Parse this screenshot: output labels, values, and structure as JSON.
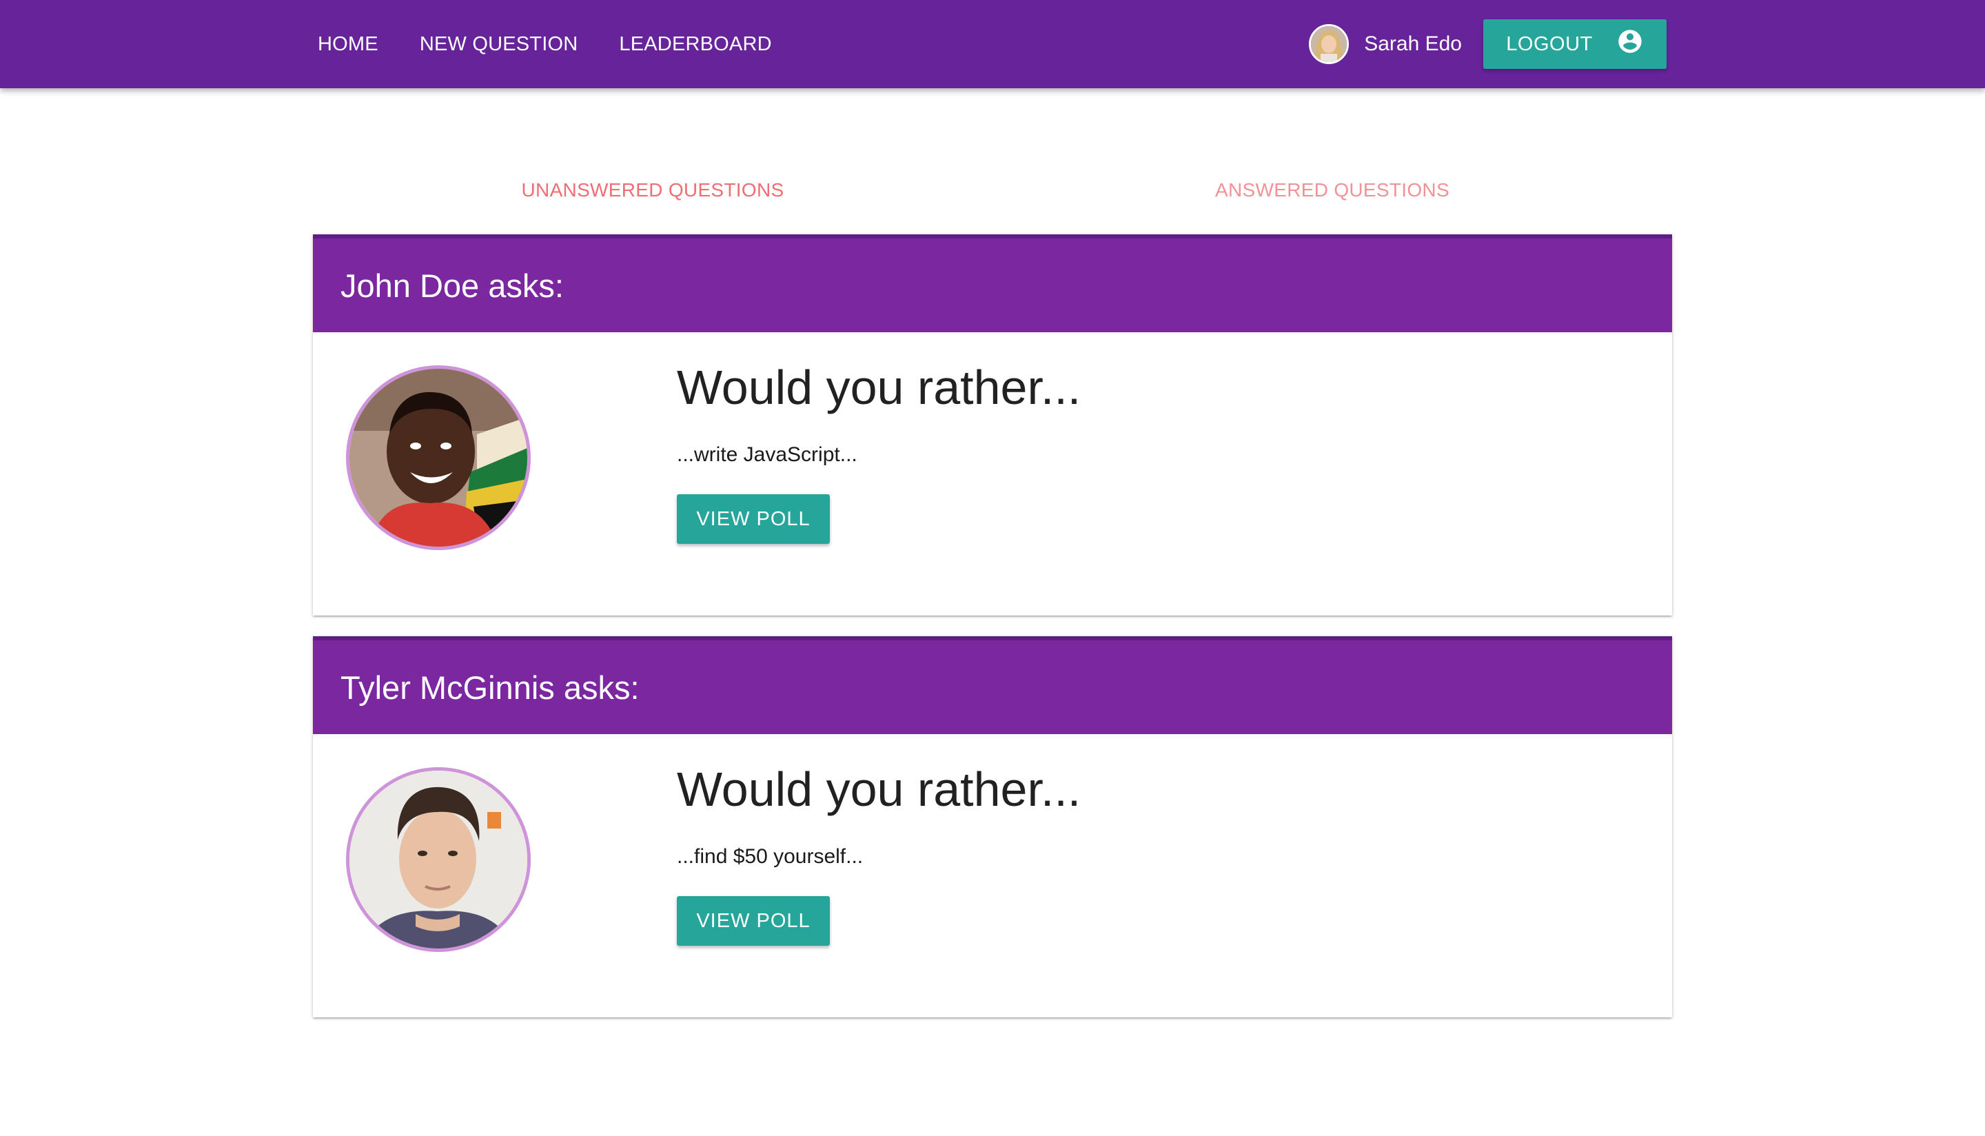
{
  "nav": {
    "links": [
      "HOME",
      "NEW QUESTION",
      "LEADERBOARD"
    ],
    "user": {
      "name": "Sarah Edo",
      "avatar_icon": "user-avatar"
    },
    "logout_label": "LOGOUT",
    "logout_icon": "account-circle-icon"
  },
  "tabs": {
    "unanswered": "UNANSWERED QUESTIONS",
    "answered": "ANSWERED QUESTIONS",
    "active": "unanswered"
  },
  "questions": [
    {
      "asker": "John Doe asks:",
      "title": "Would you rather...",
      "option": "...write JavaScript...",
      "button": "VIEW POLL"
    },
    {
      "asker": "Tyler McGinnis asks:",
      "title": "Would you rather...",
      "option": "...find $50 yourself...",
      "button": "VIEW POLL"
    }
  ],
  "colors": {
    "navbar": "#66239a",
    "card_header": "#7b27a0",
    "accent_button": "#26a69a",
    "tab_text": "#ee6e73",
    "avatar_border": "#ce93d8"
  }
}
